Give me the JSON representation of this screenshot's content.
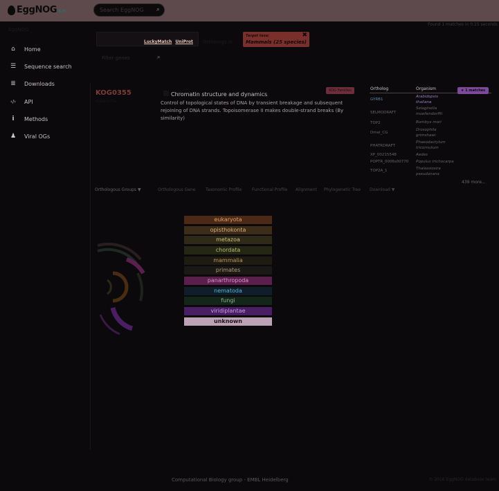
{
  "topbar": {
    "logo_text": "EggNOG",
    "logo_version": "4.5",
    "search_placeholder": "Search EggNOG",
    "search_icon": "search-icon"
  },
  "sidebar": {
    "brand": "EggNOG",
    "items": [
      {
        "label": "Home",
        "icon": "home-icon",
        "glyph": "⌂"
      },
      {
        "label": "Sequence search",
        "icon": "list-icon",
        "glyph": "☰"
      },
      {
        "label": "Downloads",
        "icon": "database-icon",
        "glyph": "≣"
      },
      {
        "label": "API",
        "icon": "code-icon",
        "glyph": "‹/›"
      },
      {
        "label": "Methods",
        "icon": "info-icon",
        "glyph": "i"
      },
      {
        "label": "Viral OGs",
        "icon": "virus-icon",
        "glyph": "♟"
      }
    ]
  },
  "header": {
    "note": "Found 1 matches in 0.15 seconds"
  },
  "taxonomy_filter": {
    "links": [
      "LuckyMatch",
      "UniProt"
    ],
    "label": "Orthologs in",
    "target_label": "Target taxa:",
    "target_value": "Mammals (25 species)",
    "close_glyph": "✖",
    "filter_placeholder": "Filter genes",
    "filter_icon": "search-icon"
  },
  "result": {
    "og_id": "KOG0355",
    "og_sub": "eukaryota",
    "category_title": "Chromatin structure and dynamics",
    "description": "Control of topological states of DNA by transient breakage and subsequent rejoining of DNA strands. Topoisomerase II makes double-strand breaks (By similarity)",
    "kog_badge": "KOG Families",
    "matches_badge": "1 matches",
    "orthologs": {
      "col_ortholog": "Ortholog",
      "col_organism": "Organism",
      "rows": [
        {
          "gene": "GYRB1",
          "organism": "Arabidopsis thaliana"
        },
        {
          "gene": "SELMODRAFT",
          "organism": "Selaginella moellendorffii"
        },
        {
          "gene": "TOP2",
          "organism": "Bombyx mori"
        },
        {
          "gene": "Dmel_CG",
          "organism": "Drosophila grimshawi"
        },
        {
          "gene": "PHATRDRAFT",
          "organism": "Phaeodactylum tricornutum"
        },
        {
          "gene": "XP_00215548",
          "organism": "Aedes"
        },
        {
          "gene": "POPTR_0006s00770",
          "organism": "Populus trichocarpa"
        },
        {
          "gene": "TOP2A_1",
          "organism": "Thalassiosira pseudonana"
        }
      ],
      "more": "439 more..."
    }
  },
  "tabs": [
    {
      "label": "Orthologous Groups",
      "glyph": "▼"
    },
    {
      "label": "Orthologous Gene",
      "glyph": ""
    },
    {
      "label": "Taxonomic Profile",
      "glyph": ""
    },
    {
      "label": "Functional Profile",
      "glyph": ""
    },
    {
      "label": "Alignment",
      "glyph": ""
    },
    {
      "label": "Phylogenetic Tree",
      "glyph": ""
    },
    {
      "label": "Download",
      "glyph": "▼"
    }
  ],
  "legend": [
    {
      "label": "eukaryota",
      "bg": "#4a2a16",
      "fg": "#e0a070"
    },
    {
      "label": "opisthokonta",
      "bg": "#3d2c18",
      "fg": "#d9b07c"
    },
    {
      "label": "metazoa",
      "bg": "#2e2a16",
      "fg": "#c8c07a"
    },
    {
      "label": "chordata",
      "bg": "#232714",
      "fg": "#b8bd78"
    },
    {
      "label": "mammalia",
      "bg": "#1e1b12",
      "fg": "#c39a55"
    },
    {
      "label": "primates",
      "bg": "#1b1915",
      "fg": "#b19c79"
    },
    {
      "label": "panarthropoda",
      "bg": "#5a1f4b",
      "fg": "#e290cf"
    },
    {
      "label": "nematoda",
      "bg": "#0f1e28",
      "fg": "#4fb6dc"
    },
    {
      "label": "fungi",
      "bg": "#14251a",
      "fg": "#8ab88a"
    },
    {
      "label": "viridiplantae",
      "bg": "#4a1e63",
      "fg": "#c9a0e8"
    },
    {
      "label": "unknown",
      "bg": "#bba3b5",
      "fg": "#1e1219"
    }
  ],
  "footer": {
    "text": "Computational Biology group - EMBL Heidelberg",
    "right": "© 2016 EggNOG database team"
  },
  "colors": {
    "topbar": "#5e4a4d",
    "background": "#0b090b",
    "target_box": "#7a2f2a",
    "matches_badge": "#7d4a9a"
  }
}
